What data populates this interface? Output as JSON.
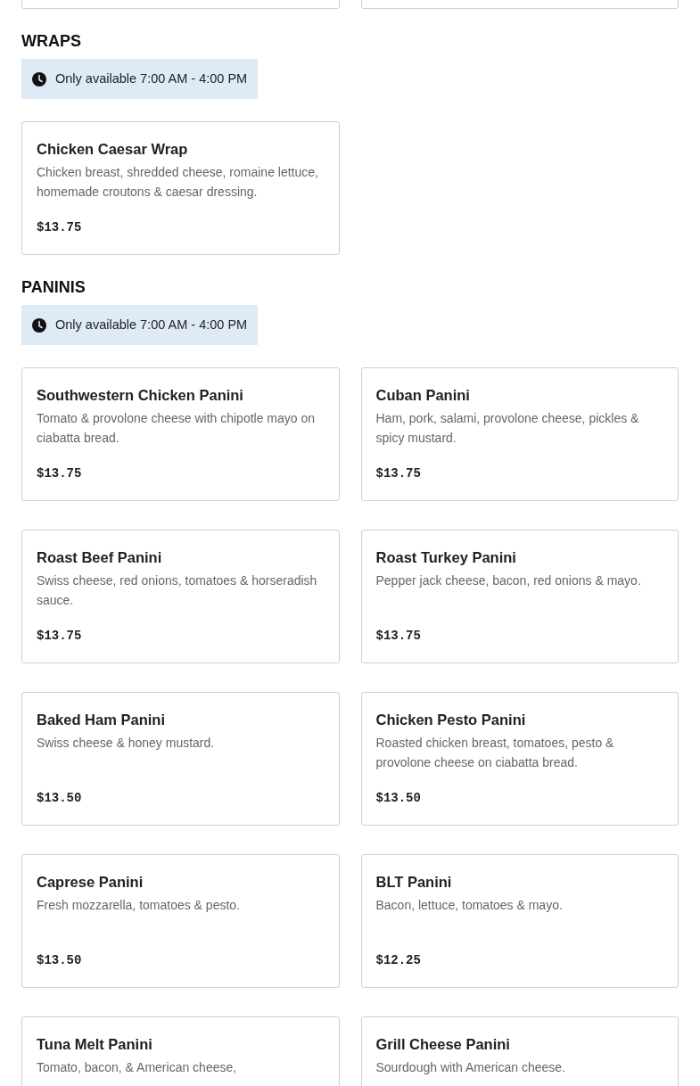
{
  "sections": [
    {
      "title": "WRAPS",
      "availability": "Only available 7:00 AM - 4:00 PM",
      "items": [
        {
          "name": "Chicken Caesar Wrap",
          "description": "Chicken breast, shredded cheese, romaine lettuce, homemade croutons & caesar dressing.",
          "price": "$13.75"
        }
      ]
    },
    {
      "title": "PANINIS",
      "availability": "Only available 7:00 AM - 4:00 PM",
      "items": [
        {
          "name": "Southwestern Chicken Panini",
          "description": "Tomato & provolone cheese with chipotle mayo on ciabatta bread.",
          "price": "$13.75"
        },
        {
          "name": "Cuban Panini",
          "description": "Ham, pork, salami, provolone cheese, pickles & spicy mustard.",
          "price": "$13.75"
        },
        {
          "name": "Roast Beef Panini",
          "description": "Swiss cheese, red onions, tomatoes & horseradish sauce.",
          "price": "$13.75"
        },
        {
          "name": "Roast Turkey Panini",
          "description": "Pepper jack cheese, bacon, red onions & mayo.",
          "price": "$13.75"
        },
        {
          "name": "Baked Ham Panini",
          "description": "Swiss cheese & honey mustard.",
          "price": "$13.50"
        },
        {
          "name": "Chicken Pesto Panini",
          "description": "Roasted chicken breast, tomatoes, pesto & provolone cheese on ciabatta bread.",
          "price": "$13.50"
        },
        {
          "name": "Caprese Panini",
          "description": "Fresh mozzarella, tomatoes & pesto.",
          "price": "$13.50"
        },
        {
          "name": "BLT Panini",
          "description": "Bacon, lettuce, tomatoes & mayo.",
          "price": "$12.25"
        },
        {
          "name": "Tuna Melt Panini",
          "description": "Tomato, bacon, & American cheese,"
        },
        {
          "name": "Grill Cheese Panini",
          "description": "Sourdough with American cheese."
        }
      ]
    }
  ]
}
